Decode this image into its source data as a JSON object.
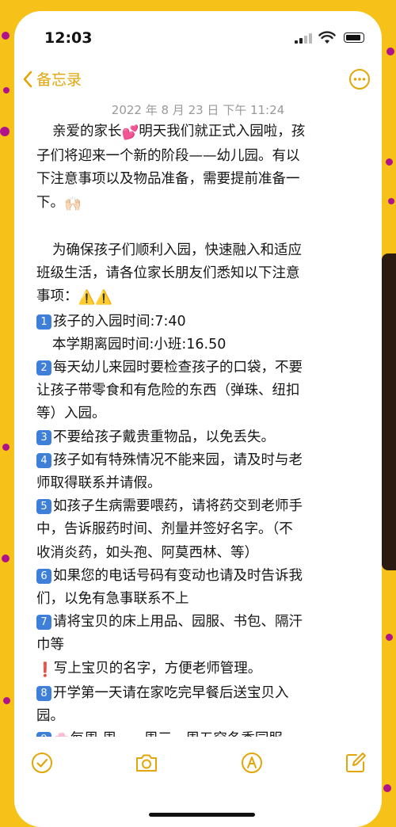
{
  "status_bar": {
    "time": "12:03"
  },
  "navbar": {
    "back_label": "备忘录"
  },
  "note": {
    "date": "2022 年 8 月 23 日  下午 11:24",
    "lines": [
      {
        "type": "text",
        "text": "亲爱的家长",
        "icon": "💕",
        "text2": "明天我们就正式入园啦，孩",
        "indent": true
      },
      {
        "type": "text",
        "text": "子们将迎来一个新的阶段——幼儿园。有以"
      },
      {
        "type": "text",
        "text": "下注意事项以及物品准备，需要提前准备一"
      },
      {
        "type": "text",
        "text": "下。",
        "icon": "🙌🏻"
      },
      {
        "type": "blank"
      },
      {
        "type": "text",
        "text": "为确保孩子们顺利入园，快速融入和适应",
        "indent": true
      },
      {
        "type": "text",
        "text": "班级生活，请各位家长朋友们悉知以下注意"
      },
      {
        "type": "text",
        "text": "事项：",
        "icon": "⚠️⚠️"
      },
      {
        "type": "num",
        "num": "1",
        "text": "孩子的入园时间:7:40"
      },
      {
        "type": "text",
        "text": "本学期离园时间:小班:16.50",
        "indent": true
      },
      {
        "type": "num",
        "num": "2",
        "text": "每天幼儿来园时要检查孩子的口袋，不要"
      },
      {
        "type": "text",
        "text": "让孩子带零食和有危险的东西（弹珠、纽扣"
      },
      {
        "type": "text",
        "text": "等）入园。"
      },
      {
        "type": "num",
        "num": "3",
        "text": "不要给孩子戴贵重物品，以免丢失。"
      },
      {
        "type": "num",
        "num": "4",
        "text": "孩子如有特殊情况不能来园，请及时与老"
      },
      {
        "type": "text",
        "text": "师取得联系并请假。"
      },
      {
        "type": "num",
        "num": "5",
        "text": "如孩子生病需要喂药，请将药交到老师手"
      },
      {
        "type": "text",
        "text": "中，告诉服药时间、剂量并签好名字。（不"
      },
      {
        "type": "text",
        "text": "收消炎药，如头孢、阿莫西林、等）"
      },
      {
        "type": "num",
        "num": "6",
        "text": "如果您的电话号码有变动也请及时告诉我"
      },
      {
        "type": "text",
        "text": "们，以免有急事联系不上"
      },
      {
        "type": "num",
        "num": "7",
        "text": "请将宝贝的床上用品、园服、书包、隔汗"
      },
      {
        "type": "text",
        "text": "巾等"
      },
      {
        "type": "text",
        "prefix_icon": "❗",
        "text": "写上宝贝的名字，方便老师管理。"
      },
      {
        "type": "num",
        "num": "8",
        "text": "开学第一天请在家吃完早餐后送宝贝入"
      },
      {
        "type": "text",
        "text": "园。"
      },
      {
        "type": "num",
        "num": "9",
        "prefix_icon": "🌸",
        "text": "每周 周一、周三、周五穿冬季园服"
      }
    ]
  },
  "icons": {
    "back": "chevron-left-icon",
    "more": "ellipsis-circle-icon",
    "checklist": "checklist-icon",
    "camera": "camera-icon",
    "markup": "markup-pen-icon",
    "compose": "compose-icon"
  },
  "colors": {
    "accent": "#e3a60a",
    "background": "#f6c21a",
    "number_badge": "#3d7fd9"
  }
}
